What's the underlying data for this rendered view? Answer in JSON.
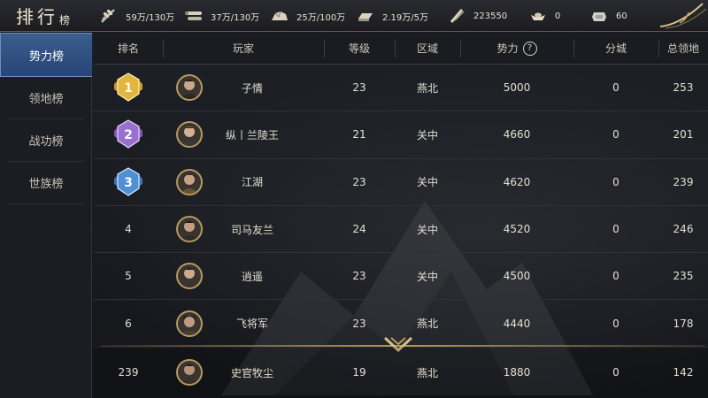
{
  "header": {
    "title_main": "排行",
    "title_small": "榜"
  },
  "resources": [
    {
      "icon": "grain-icon",
      "value": "59万/130万"
    },
    {
      "icon": "wood-icon",
      "value": "37万/130万"
    },
    {
      "icon": "stone-icon",
      "value": "25万/100万"
    },
    {
      "icon": "iron-icon",
      "value": "2.19万/5万"
    },
    {
      "icon": "decree-icon",
      "value": "223550"
    },
    {
      "icon": "gold-ingot-icon",
      "value": "0"
    },
    {
      "icon": "silver-ingot-icon",
      "value": "60"
    }
  ],
  "sidebar": {
    "items": [
      {
        "label": "势力榜",
        "active": true
      },
      {
        "label": "领地榜",
        "active": false
      },
      {
        "label": "战功榜",
        "active": false
      },
      {
        "label": "世族榜",
        "active": false
      }
    ]
  },
  "table": {
    "headers": {
      "rank": "排名",
      "player": "玩家",
      "level": "等级",
      "region": "区域",
      "power": "势力",
      "help": "?",
      "sub_cities": "分城",
      "total_land": "总领地"
    },
    "rows": [
      {
        "rank": "1",
        "name": "子情",
        "level": "23",
        "region": "燕北",
        "power": "5000",
        "sub_cities": "0",
        "total_land": "253"
      },
      {
        "rank": "2",
        "name": "纵丨兰陵王",
        "level": "21",
        "region": "关中",
        "power": "4660",
        "sub_cities": "0",
        "total_land": "201"
      },
      {
        "rank": "3",
        "name": "江湖",
        "level": "23",
        "region": "关中",
        "power": "4620",
        "sub_cities": "0",
        "total_land": "239"
      },
      {
        "rank": "4",
        "name": "司马友兰",
        "level": "24",
        "region": "关中",
        "power": "4520",
        "sub_cities": "0",
        "total_land": "246"
      },
      {
        "rank": "5",
        "name": "逍遥",
        "level": "23",
        "region": "关中",
        "power": "4500",
        "sub_cities": "0",
        "total_land": "235"
      },
      {
        "rank": "6",
        "name": "飞将军",
        "level": "23",
        "region": "燕北",
        "power": "4440",
        "sub_cities": "0",
        "total_land": "178"
      }
    ],
    "self_row": {
      "rank": "239",
      "name": "史官牧尘",
      "level": "19",
      "region": "燕北",
      "power": "1880",
      "sub_cities": "0",
      "total_land": "142"
    }
  },
  "colors": {
    "gold_accent": "#b8975a",
    "active_tab": "#3b5d8f",
    "medal_gold": "#e0b640",
    "medal_purple": "#9a6fd0",
    "medal_blue": "#4f8fd6"
  }
}
